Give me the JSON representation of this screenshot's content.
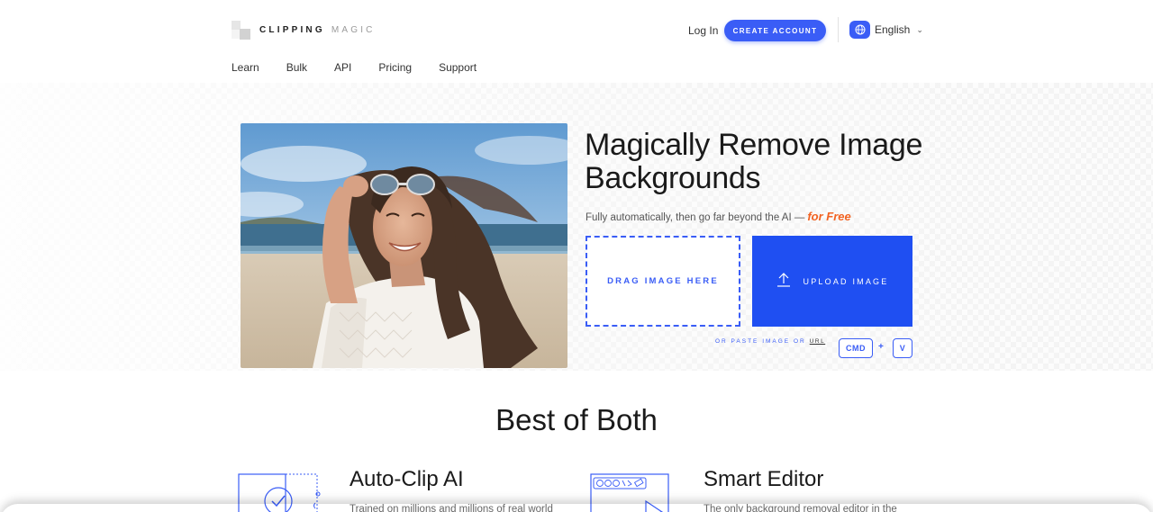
{
  "brand": {
    "word1": "CLIPPING",
    "word2": "MAGIC"
  },
  "header": {
    "login_label": "Log In",
    "create_account_label": "CREATE ACCOUNT",
    "language_label": "English",
    "accent_color": "#3a5df6"
  },
  "nav": {
    "items": [
      {
        "label": "Learn"
      },
      {
        "label": "Bulk"
      },
      {
        "label": "API"
      },
      {
        "label": "Pricing"
      },
      {
        "label": "Support"
      }
    ]
  },
  "hero": {
    "image_alt": "Smiling woman holding sunglasses on a beach",
    "title": "Magically Remove Image Backgrounds",
    "subtitle": "Fully automatically, then go far beyond the AI —",
    "subtitle_highlight": "for Free",
    "highlight_color": "#f26322",
    "drag_label": "DRAG IMAGE HERE",
    "upload_label": "UPLOAD IMAGE",
    "paste_text": "OR PASTE IMAGE OR",
    "paste_url_label": "URL",
    "key_cmd": "CMD",
    "key_plus": "+",
    "key_v": "V"
  },
  "section": {
    "title": "Best of Both",
    "features": [
      {
        "title": "Auto-Clip AI",
        "description": "Trained on millions and millions of real world",
        "icon": "auto-clip-icon"
      },
      {
        "title": "Smart Editor",
        "description": "The only background removal editor in the",
        "icon": "smart-editor-icon"
      }
    ]
  }
}
